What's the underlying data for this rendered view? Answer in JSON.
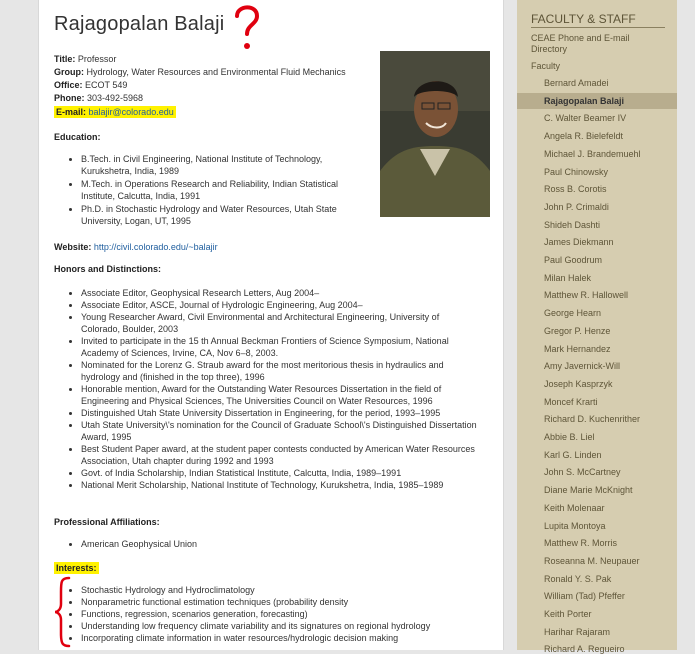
{
  "profile": {
    "name": "Rajagopalan Balaji",
    "title_label": "Title:",
    "title": "Professor",
    "group_label": "Group:",
    "group": "Hydrology, Water Resources and Environmental Fluid Mechanics",
    "office_label": "Office:",
    "office": "ECOT 549",
    "phone_label": "Phone:",
    "phone": "303-492-5968",
    "email_label": "E-mail:",
    "email": "balajir@colorado.edu",
    "website_label": "Website:",
    "website": "http://civil.colorado.edu/~balajir"
  },
  "education": {
    "heading": "Education:",
    "items": [
      "B.Tech. in Civil Engineering, National Institute of Technology, Kurukshetra, India, 1989",
      "M.Tech. in Operations Research and Reliability, Indian Statistical Institute, Calcutta, India, 1991",
      "Ph.D. in Stochastic Hydrology and Water Resources, Utah State University, Logan, UT, 1995"
    ]
  },
  "honors": {
    "heading": "Honors and Distinctions:",
    "items": [
      "Associate Editor, Geophysical Research Letters, Aug 2004–",
      "Associate Editor, ASCE, Journal of Hydrologic Engineering, Aug 2004–",
      "Young Researcher Award, Civil Environmental and Architectural Engineering, University of Colorado, Boulder, 2003",
      "Invited to participate in the 15 th Annual Beckman Frontiers of Science Symposium, National Academy of Sciences, Irvine, CA, Nov 6–8, 2003.",
      "Nominated for the Lorenz G. Straub award for the most meritorious thesis in hydraulics and hydrology and (finished in the top three), 1996",
      "Honorable mention, Award for the Outstanding Water Resources Dissertation in the field of Engineering and Physical Sciences, The Universities Council on Water Resources, 1996",
      "Distinguished Utah State University Dissertation in Engineering, for the period, 1993–1995",
      "Utah State University\\'s nomination for the Council of Graduate School\\'s Distinguished Dissertation Award, 1995",
      "Best Student Paper award, at the student paper contests conducted by American Water Resources Association, Utah chapter during 1992 and 1993",
      "Govt. of India Scholarship, Indian Statistical Institute, Calcutta, India, 1989–1991",
      "National Merit Scholarship, National Institute of Technology, Kurukshetra, India, 1985–1989"
    ]
  },
  "affiliations": {
    "heading": "Professional Affiliations:",
    "items": [
      "American Geophysical Union"
    ]
  },
  "interests": {
    "heading": "Interests:",
    "items": [
      "Stochastic Hydrology and Hydroclimatology",
      "Nonparametric functional estimation techniques (probability density",
      "Functions, regression, scenarios generation, forecasting)",
      "Understanding low frequency climate variability and its signatures on regional hydrology",
      "Incorporating climate information in water resources/hydrologic decision making"
    ]
  },
  "sidebar": {
    "heading": "FACULTY & STAFF",
    "phone_link": "CEAE Phone and E-mail Directory",
    "faculty_label": "Faculty",
    "active": "Rajagopalan Balaji",
    "faculty": [
      "Bernard Amadei",
      "Rajagopalan Balaji",
      "C. Walter Beamer IV",
      "Angela R. Bielefeldt",
      "Michael J. Brandemuehl",
      "Paul Chinowsky",
      "Ross B. Corotis",
      "John P. Crimaldi",
      "Shideh Dashti",
      "James Diekmann",
      "Paul Goodrum",
      "Milan Halek",
      "Matthew R. Hallowell",
      "George Hearn",
      "Gregor P. Henze",
      "Mark Hernandez",
      "Amy Javernick-Will",
      "Joseph Kasprzyk",
      "Moncef Krarti",
      "Richard D. Kuchenrither",
      "Abbie B. Liel",
      "Karl G. Linden",
      "John S. McCartney",
      "Diane Marie McKnight",
      "Keith Molenaar",
      "Lupita Montoya",
      "Matthew R. Morris",
      "Roseanna M. Neupauer",
      "Ronald Y. S. Pak",
      "William (Tad) Pfeffer",
      "Keith Porter",
      "Harihar Rajaram",
      "Richard A. Regueiro"
    ]
  },
  "colors": {
    "highlight": "#fff200",
    "annotation": "#e0000f",
    "link": "#1f5e9e",
    "sidebar": "#d6cdb0"
  },
  "icons": {
    "annotation_mark": "question-mark",
    "annotation_brace": "curly-brace"
  }
}
